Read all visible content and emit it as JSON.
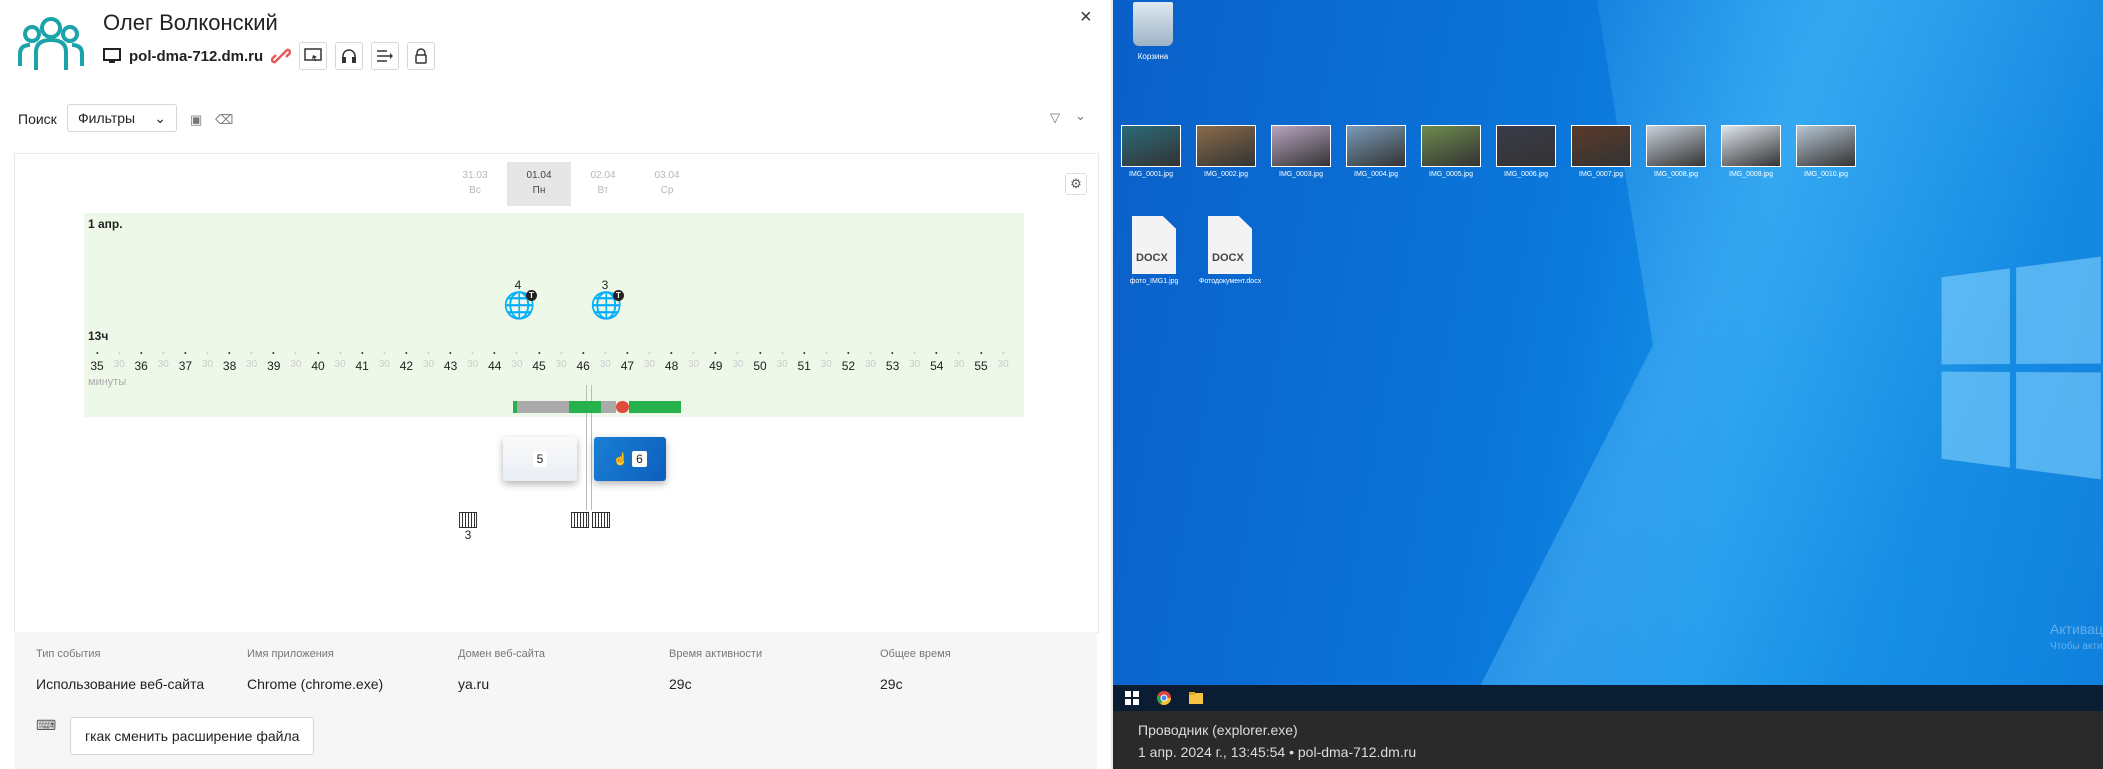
{
  "header": {
    "user_name": "Олег Волконский",
    "hostname": "pol-dma-712.dm.ru",
    "close_label": "×"
  },
  "search": {
    "label": "Поиск",
    "filters_label": "Фильтры",
    "filters_chevron": "⌄"
  },
  "dates": [
    {
      "date": "31.03",
      "day": "Вс"
    },
    {
      "date": "01.04",
      "day": "Пн",
      "active": true
    },
    {
      "date": "02.04",
      "day": "Вт"
    },
    {
      "date": "03.04",
      "day": "Ср"
    }
  ],
  "timeline": {
    "day_label": "1 апр.",
    "hour_label": "13ч",
    "minutes_caption": "минуты",
    "minutes": [
      "35",
      "36",
      "37",
      "38",
      "39",
      "40",
      "41",
      "42",
      "43",
      "44",
      "45",
      "46",
      "47",
      "48",
      "49",
      "50",
      "51",
      "52",
      "53",
      "54",
      "55"
    ],
    "half_label": "30",
    "globes": [
      {
        "count": "4"
      },
      {
        "count": "3"
      }
    ],
    "thumbnails": [
      {
        "count": "5"
      },
      {
        "count": "6"
      }
    ],
    "process_count": "3"
  },
  "details": {
    "columns": [
      {
        "head": "Тип события",
        "value": "Использование веб-сайта"
      },
      {
        "head": "Имя приложения",
        "value": "Chrome (chrome.exe)"
      },
      {
        "head": "Домен веб-сайта",
        "value": "ya.ru"
      },
      {
        "head": "Время активности",
        "value": "29с"
      },
      {
        "head": "Общее время",
        "value": "29с"
      }
    ],
    "query": "гкак сменить расширение файла"
  },
  "desktop": {
    "recycle_label": "Корзина",
    "photos": [
      "IMG_0001.jpg",
      "IMG_0002.jpg",
      "IMG_0003.jpg",
      "IMG_0004.jpg",
      "IMG_0005.jpg",
      "IMG_0006.jpg",
      "IMG_0007.jpg",
      "IMG_0008.jpg",
      "IMG_0009.jpg",
      "IMG_0010.jpg"
    ],
    "docs": [
      {
        "type": "DOCX",
        "name": "фото_IMG1.jpg"
      },
      {
        "type": "DOCX",
        "name": "Фотодокумент.docx"
      }
    ],
    "activate_l1": "Активаци",
    "activate_l2": "Чтобы актив"
  },
  "caption": {
    "process": "Проводник (explorer.exe)",
    "datetime": "1 апр. 2024 г., 13:45:54 • pol-dma-712.dm.ru"
  },
  "colors": {
    "green_area": "#eef8e8",
    "bar_gray": "#aaaaaa",
    "bar_green": "#26b14c",
    "bar_red": "#e04b3c"
  }
}
